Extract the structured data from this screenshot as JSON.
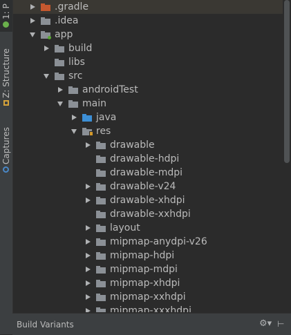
{
  "side_tabs": {
    "project": "1: P",
    "structure": "Z: Structure",
    "captures": "Captures"
  },
  "tree": {
    "items": [
      {
        "label": ".gradle",
        "icon": "folder-orange",
        "expander": "collapsed"
      },
      {
        "label": ".idea",
        "icon": "folder",
        "expander": "collapsed"
      },
      {
        "label": "app",
        "icon": "module-folder",
        "expander": "expanded"
      },
      {
        "label": "build",
        "icon": "folder",
        "expander": "collapsed"
      },
      {
        "label": "libs",
        "icon": "folder",
        "expander": "none"
      },
      {
        "label": "src",
        "icon": "folder",
        "expander": "expanded"
      },
      {
        "label": "androidTest",
        "icon": "folder",
        "expander": "collapsed"
      },
      {
        "label": "main",
        "icon": "folder",
        "expander": "expanded"
      },
      {
        "label": "java",
        "icon": "folder-blue",
        "expander": "collapsed"
      },
      {
        "label": "res",
        "icon": "resource-folder",
        "expander": "expanded"
      },
      {
        "label": "drawable",
        "icon": "folder",
        "expander": "collapsed"
      },
      {
        "label": "drawable-hdpi",
        "icon": "folder",
        "expander": "none"
      },
      {
        "label": "drawable-mdpi",
        "icon": "folder",
        "expander": "none"
      },
      {
        "label": "drawable-v24",
        "icon": "folder",
        "expander": "collapsed"
      },
      {
        "label": "drawable-xhdpi",
        "icon": "folder",
        "expander": "collapsed"
      },
      {
        "label": "drawable-xxhdpi",
        "icon": "folder",
        "expander": "none"
      },
      {
        "label": "layout",
        "icon": "folder",
        "expander": "collapsed"
      },
      {
        "label": "mipmap-anydpi-v26",
        "icon": "folder",
        "expander": "collapsed"
      },
      {
        "label": "mipmap-hdpi",
        "icon": "folder",
        "expander": "collapsed"
      },
      {
        "label": "mipmap-mdpi",
        "icon": "folder",
        "expander": "collapsed"
      },
      {
        "label": "mipmap-xhdpi",
        "icon": "folder",
        "expander": "collapsed"
      },
      {
        "label": "mipmap-xxhdpi",
        "icon": "folder",
        "expander": "collapsed"
      },
      {
        "label": "mipmap-xxxhdpi",
        "icon": "folder",
        "expander": "collapsed"
      }
    ]
  },
  "bottom_bar": {
    "label": "Build Variants"
  },
  "colors": {
    "background": "#2b2b2b",
    "panel": "#3c3f41",
    "text": "#bbbbbb",
    "folder": "#8b9096",
    "folder_orange": "#c4582f",
    "folder_blue": "#3c8fd6",
    "selection": "#3a3833"
  }
}
